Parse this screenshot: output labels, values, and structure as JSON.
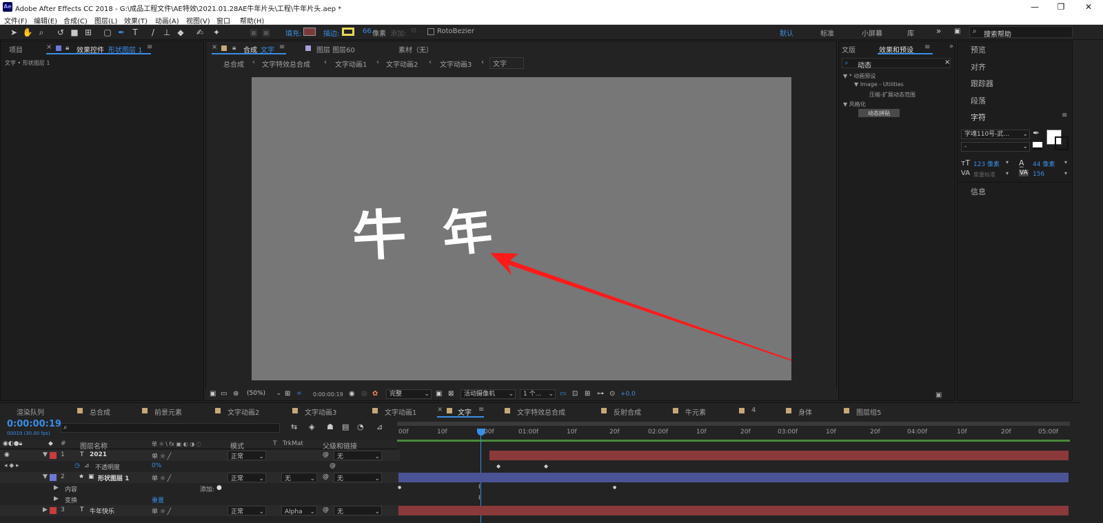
{
  "window": {
    "app_icon": "Ae",
    "title": "Adobe After Effects CC 2018 - G:\\成品工程文件\\AE特效\\2021.01.28AE牛年片头\\工程\\牛年片头.aep *",
    "minimize": "—",
    "maximize": "❐",
    "close": "✕"
  },
  "menu": [
    "文件(F)",
    "编辑(E)",
    "合成(C)",
    "图层(L)",
    "效果(T)",
    "动画(A)",
    "视图(V)",
    "窗口",
    "帮助(H)"
  ],
  "toolbar": {
    "fill_label": "填充:",
    "stroke_label": "描边:",
    "stroke_width": "66",
    "stroke_unit": "像素",
    "add_label": "添加:",
    "rotobezier": "RotoBezier",
    "workspaces": [
      "默认",
      "标准",
      "小屏幕",
      "库"
    ],
    "search_placeholder": "搜索帮助"
  },
  "left_panel": {
    "tab_project": "项目",
    "tab_effects": "效果控件",
    "tab_effects_layer": "形状图层 1",
    "breadcrumb": "文字 • 形状图层 1"
  },
  "viewer": {
    "tab_comp_prefix": "合成",
    "tab_comp_name": "文字",
    "tab_layer": "图层 图层60",
    "tab_footage": "素材（无）",
    "crumbs": [
      "总合成",
      "文字特效总合成",
      "文字动画1",
      "文字动画2",
      "文字动画3",
      "文字"
    ],
    "canvas_text_1": "牛",
    "canvas_text_2": "年",
    "zoom": "(50%)",
    "timecode": "0:00:00:19",
    "resolution": "完整",
    "camera": "活动摄像机",
    "views": "1 个...",
    "exposure": "+0.0",
    "colors": {
      "canvas": "#777777",
      "arrow": "#ff1a1a"
    }
  },
  "effects_panel": {
    "tab_library": "文版",
    "tab_effects": "效果和预设",
    "search_value": "动态",
    "tree": [
      "▼ * 动画预设",
      "▼ Image - Utilities",
      "压缩-扩展动态范围",
      "▼ 风格化",
      "动态拼贴"
    ]
  },
  "right_panel": {
    "items": [
      "预览",
      "对齐",
      "跟踪器",
      "段落"
    ],
    "character_title": "字符",
    "font": "字魂110号-武...",
    "style": "-",
    "font_size": "123 像素",
    "leading": "44 像素",
    "kerning": "度量标准",
    "tracking": "156",
    "info": "信息"
  },
  "timeline": {
    "tabs": [
      "渲染队列",
      "总合成",
      "前景元素",
      "文字动画2",
      "文字动画3",
      "文字动画1",
      "文字",
      "文字特效总合成",
      "反射合成",
      "牛元素",
      "4",
      "身体",
      "图层组5"
    ],
    "timecode": "0:00:00:19",
    "fps": "00019 (30.00 fps)",
    "columns": {
      "name": "图层名称",
      "switches": "单 ☼ \\ fx ▣ ◐ ◑ ◌",
      "mode": "模式",
      "t": "T",
      "trkmat": "TrkMat",
      "parent": "父级和链接"
    },
    "ruler": [
      "00f",
      "10f",
      "00f",
      "01:00f",
      "10f",
      "20f",
      "02:00f",
      "10f",
      "20f",
      "03:00f",
      "10f",
      "20f",
      "04:00f",
      "10f",
      "20f",
      "05:00f"
    ],
    "layers": [
      {
        "num": "1",
        "type": "T",
        "name": "2021",
        "mode": "正常",
        "trkmat": "",
        "parent": "无",
        "color": "#c83c3c"
      },
      {
        "num": "",
        "type": "",
        "name": "不透明度",
        "value": "0%"
      },
      {
        "num": "2",
        "type": "★",
        "name": "形状图层 1",
        "mode": "正常",
        "trkmat": "无",
        "parent": "无",
        "color": "#6c78d8"
      },
      {
        "num": "",
        "type": "",
        "name": "内容",
        "value": "添加:"
      },
      {
        "num": "",
        "type": "",
        "name": "变换",
        "value": "重置"
      },
      {
        "num": "3",
        "type": "T",
        "name": "牛年快乐",
        "mode": "正常",
        "trkmat": "Alpha",
        "parent": "无",
        "color": "#c83c3c"
      }
    ]
  }
}
